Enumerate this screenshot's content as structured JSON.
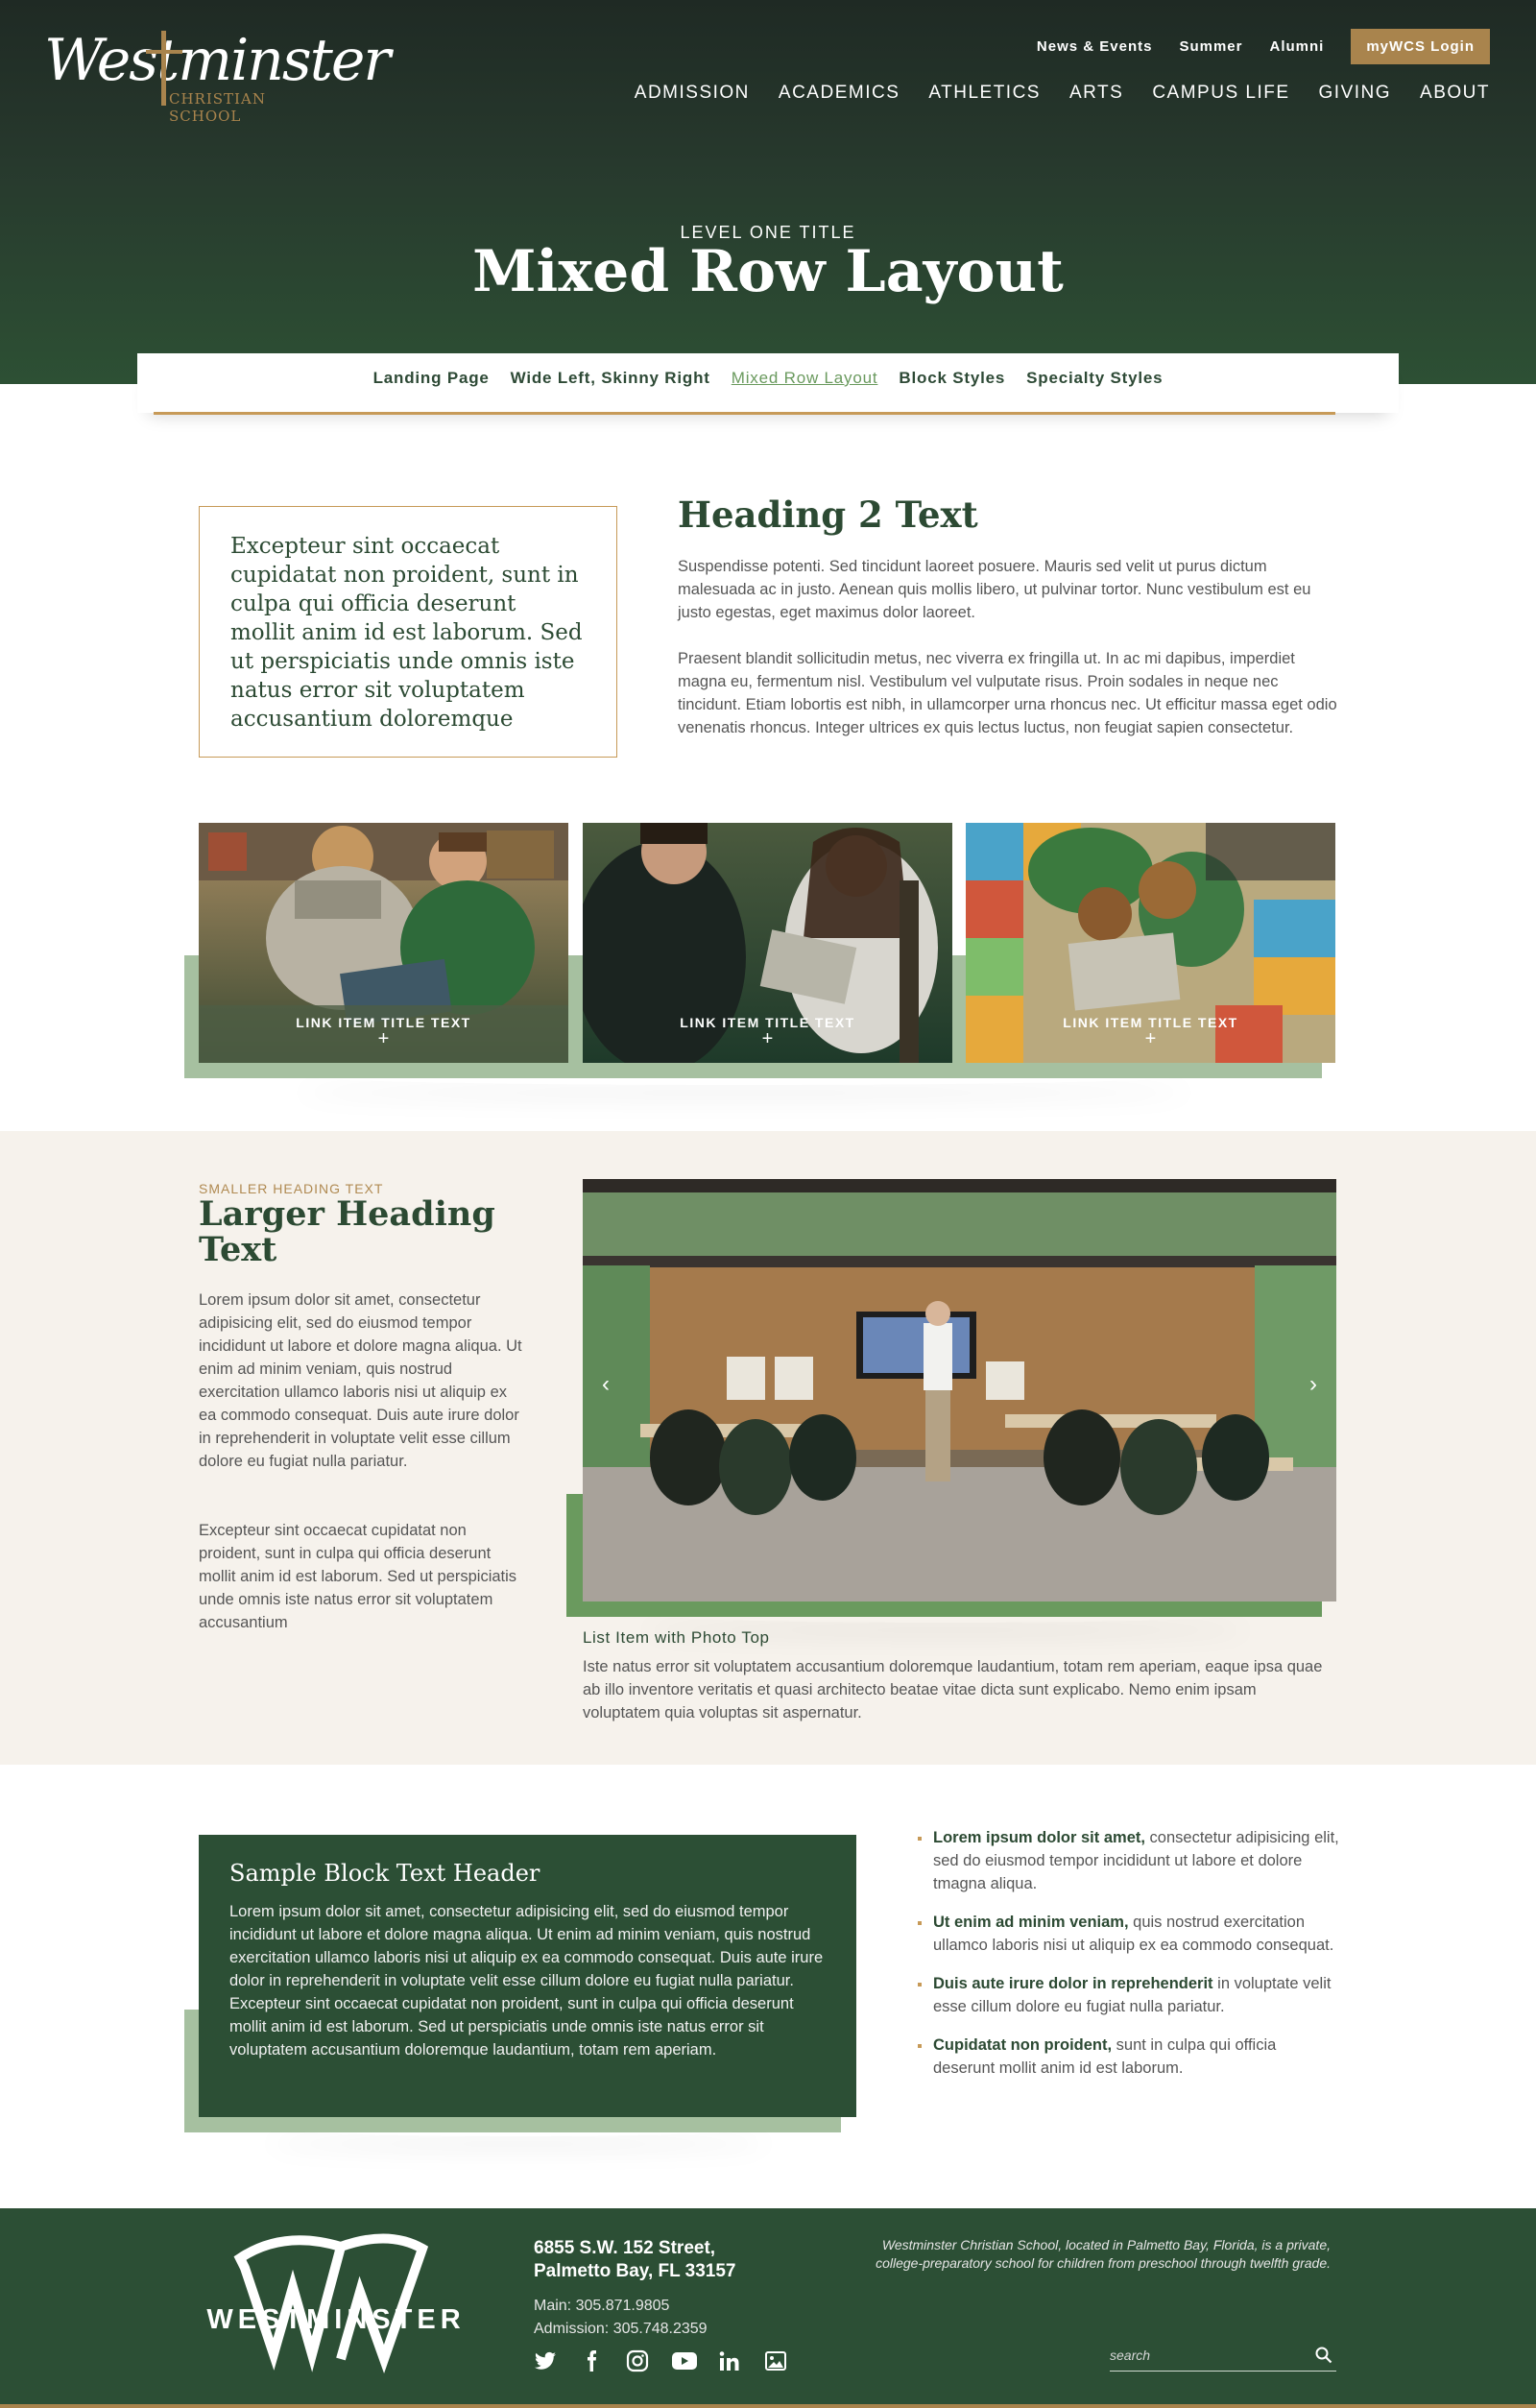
{
  "header": {
    "logo": {
      "script_text": "Westminster",
      "sub_text": "CHRISTIAN SCHOOL"
    },
    "utility_links": [
      "News & Events",
      "Summer",
      "Alumni"
    ],
    "login_label": "myWCS Login",
    "main_nav": [
      "ADMISSION",
      "ACADEMICS",
      "ATHLETICS",
      "ARTS",
      "CAMPUS LIFE",
      "GIVING",
      "ABOUT"
    ],
    "kicker": "LEVEL ONE TITLE",
    "title": "Mixed Row Layout"
  },
  "subnav": {
    "items": [
      "Landing Page",
      "Wide Left, Skinny Right",
      "Mixed Row Layout",
      "Block Styles",
      "Specialty Styles"
    ],
    "active": "Mixed Row Layout"
  },
  "row1": {
    "quote": "Excepteur sint occaecat cupidatat non proident, sunt in culpa qui officia deserunt mollit anim id est laborum. Sed ut perspiciatis unde omnis iste natus error sit voluptatem accusantium doloremque",
    "heading": "Heading 2 Text",
    "para1": "Suspendisse potenti. Sed tincidunt laoreet posuere. Mauris sed velit ut purus dictum malesuada ac in justo. Aenean quis mollis libero, ut pulvinar tortor. Nunc vestibulum est eu justo egestas, eget maximus dolor laoreet.",
    "para2": "Praesent blandit sollicitudin metus, nec viverra ex fringilla ut. In ac mi dapibus, imperdiet magna eu, fermentum nisl. Vestibulum vel vulputate risus. Proin sodales in neque nec tincidunt. Etiam lobortis est nibh, in ullamcorper urna rhoncus nec. Ut efficitur massa eget odio venenatis rhoncus. Integer ultrices ex quis lectus luctus, non feugiat sapien consectetur."
  },
  "cards": [
    {
      "title": "LINK ITEM TITLE TEXT",
      "plus": "+"
    },
    {
      "title": "LINK ITEM TITLE TEXT",
      "plus": "+"
    },
    {
      "title": "LINK ITEM TITLE TEXT",
      "plus": "+"
    }
  ],
  "band": {
    "small_heading": "SMALLER HEADING TEXT",
    "large_heading": "Larger Heading Text",
    "para1": "Lorem ipsum dolor sit amet, consectetur adipisicing elit, sed do eiusmod tempor incididunt ut labore et dolore magna aliqua. Ut enim ad minim veniam, quis nostrud exercitation ullamco laboris nisi ut aliquip ex ea commodo consequat. Duis aute irure dolor in reprehenderit in voluptate velit esse cillum dolore eu fugiat nulla pariatur.",
    "para2": "Excepteur sint occaecat cupidatat non proident, sunt in culpa qui officia deserunt mollit anim id est laborum. Sed ut perspiciatis unde omnis iste natus error sit voluptatem accusantium",
    "list_title": "List Item with Photo Top",
    "list_desc": "Iste natus error sit voluptatem accusantium doloremque laudantium, totam rem aperiam, eaque ipsa quae ab illo inventore veritatis et quasi architecto beatae vitae dicta sunt explicabo. Nemo enim ipsam voluptatem quia voluptas sit aspernatur."
  },
  "block": {
    "header": "Sample Block Text Header",
    "text": "Lorem ipsum dolor sit amet, consectetur adipisicing elit, sed do eiusmod tempor incididunt ut labore et dolore magna aliqua. Ut enim ad minim veniam, quis nostrud exercitation ullamco laboris nisi ut aliquip ex ea commodo consequat. Duis aute irure dolor in reprehenderit in voluptate velit esse cillum dolore eu fugiat nulla pariatur. Excepteur sint occaecat cupidatat non proident, sunt in culpa qui officia deserunt mollit anim id est laborum. Sed ut perspiciatis unde omnis iste natus error sit voluptatem accusantium doloremque laudantium, totam rem aperiam."
  },
  "bullets": [
    {
      "bold": "Lorem ipsum dolor sit amet,",
      "rest": " consectetur adipisicing elit, sed do eiusmod tempor incididunt ut labore et dolore tmagna aliqua."
    },
    {
      "bold": "Ut enim ad minim veniam,",
      "rest": " quis nostrud exercitation ullamco laboris nisi ut aliquip ex ea commodo consequat."
    },
    {
      "bold": "Duis aute irure dolor in reprehenderit",
      "rest": " in voluptate velit esse cillum dolore eu fugiat nulla pariatur."
    },
    {
      "bold": "Cupidatat non proident,",
      "rest": " sunt in culpa qui officia deserunt mollit anim id est laborum."
    }
  ],
  "footer": {
    "logo_word": "WESTMINSTER",
    "address_line1": "6855 S.W. 152 Street,",
    "address_line2": "Palmetto Bay, FL 33157",
    "main_phone": "Main: 305.871.9805",
    "admission_phone": "Admission: 305.748.2359",
    "social_icons": [
      "twitter-icon",
      "facebook-icon",
      "instagram-icon",
      "youtube-icon",
      "linkedin-icon",
      "photo-icon"
    ],
    "blurb": "Westminster Christian School, located in Palmetto Bay, Florida, is a private, college-preparatory school for children from preschool through twelfth grade.",
    "search_placeholder": "search"
  },
  "colors": {
    "brand_green": "#2c4f35",
    "gold": "#a9844d",
    "accent_light_green": "#a6c0a0",
    "accent_green": "#6a9a5e",
    "band_bg": "#f6f2ec"
  }
}
